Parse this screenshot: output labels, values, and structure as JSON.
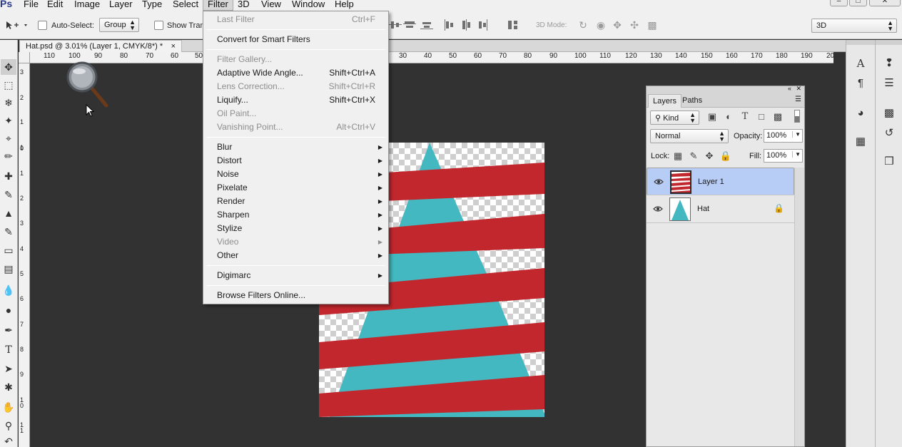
{
  "menubar": {
    "app_logo": "Ps",
    "items": [
      "File",
      "Edit",
      "Image",
      "Layer",
      "Type",
      "Select",
      "Filter",
      "3D",
      "View",
      "Window",
      "Help"
    ],
    "active": "Filter"
  },
  "options_bar": {
    "auto_select_label": "Auto-Select:",
    "auto_select_value": "Group",
    "show_transform_label": "Show Tran:",
    "mode_3d_label": "3D Mode:",
    "workspace_value": "3D"
  },
  "document": {
    "tab_title": "Hat.psd @ 3.01% (Layer 1, CMYK/8*) *",
    "close_glyph": "×"
  },
  "rulers": {
    "h_labels_left": [
      "110",
      "100",
      "90",
      "80",
      "70",
      "60",
      "50"
    ],
    "h_labels_right": [
      "30",
      "40",
      "50",
      "60",
      "70",
      "80",
      "90",
      "100",
      "110",
      "120",
      "130",
      "140",
      "150",
      "160",
      "170",
      "180",
      "190",
      "20"
    ],
    "v_labels": [
      "3",
      "2",
      "1",
      "1",
      "0",
      "1",
      "2",
      "3",
      "4",
      "5",
      "6",
      "7",
      "8",
      "9",
      "10",
      "11"
    ]
  },
  "filter_menu": {
    "groups": [
      [
        {
          "label": "Last Filter",
          "shortcut": "Ctrl+F",
          "disabled": true,
          "submenu": false
        }
      ],
      [
        {
          "label": "Convert for Smart Filters",
          "shortcut": "",
          "disabled": false,
          "submenu": false
        }
      ],
      [
        {
          "label": "Filter Gallery...",
          "shortcut": "",
          "disabled": true,
          "submenu": false
        },
        {
          "label": "Adaptive Wide Angle...",
          "shortcut": "Shift+Ctrl+A",
          "disabled": false,
          "submenu": false
        },
        {
          "label": "Lens Correction...",
          "shortcut": "Shift+Ctrl+R",
          "disabled": true,
          "submenu": false
        },
        {
          "label": "Liquify...",
          "shortcut": "Shift+Ctrl+X",
          "disabled": false,
          "submenu": false
        },
        {
          "label": "Oil Paint...",
          "shortcut": "",
          "disabled": true,
          "submenu": false
        },
        {
          "label": "Vanishing Point...",
          "shortcut": "Alt+Ctrl+V",
          "disabled": true,
          "submenu": false
        }
      ],
      [
        {
          "label": "Blur",
          "shortcut": "",
          "disabled": false,
          "submenu": true
        },
        {
          "label": "Distort",
          "shortcut": "",
          "disabled": false,
          "submenu": true
        },
        {
          "label": "Noise",
          "shortcut": "",
          "disabled": false,
          "submenu": true
        },
        {
          "label": "Pixelate",
          "shortcut": "",
          "disabled": false,
          "submenu": true
        },
        {
          "label": "Render",
          "shortcut": "",
          "disabled": false,
          "submenu": true
        },
        {
          "label": "Sharpen",
          "shortcut": "",
          "disabled": false,
          "submenu": true
        },
        {
          "label": "Stylize",
          "shortcut": "",
          "disabled": false,
          "submenu": true
        },
        {
          "label": "Video",
          "shortcut": "",
          "disabled": true,
          "submenu": true
        },
        {
          "label": "Other",
          "shortcut": "",
          "disabled": false,
          "submenu": true
        }
      ],
      [
        {
          "label": "Digimarc",
          "shortcut": "",
          "disabled": false,
          "submenu": true
        }
      ],
      [
        {
          "label": "Browse Filters Online...",
          "shortcut": "",
          "disabled": false,
          "submenu": false
        }
      ]
    ]
  },
  "layers_panel": {
    "tabs": [
      "Layers",
      "Paths"
    ],
    "active_tab": "Layers",
    "filter_kind": "Kind",
    "blend_mode": "Normal",
    "opacity_label": "Opacity:",
    "opacity_value": "100%",
    "lock_label": "Lock:",
    "fill_label": "Fill:",
    "fill_value": "100%",
    "layers": [
      {
        "name": "Layer 1",
        "selected": true,
        "locked": false,
        "visible": true
      },
      {
        "name": "Hat",
        "selected": false,
        "locked": true,
        "visible": true
      }
    ]
  },
  "colors": {
    "hat_teal": "#44b8c1",
    "stripe_red": "#c1272d",
    "selection_blue": "#b8cdf5",
    "workspace_bg": "#323232"
  }
}
